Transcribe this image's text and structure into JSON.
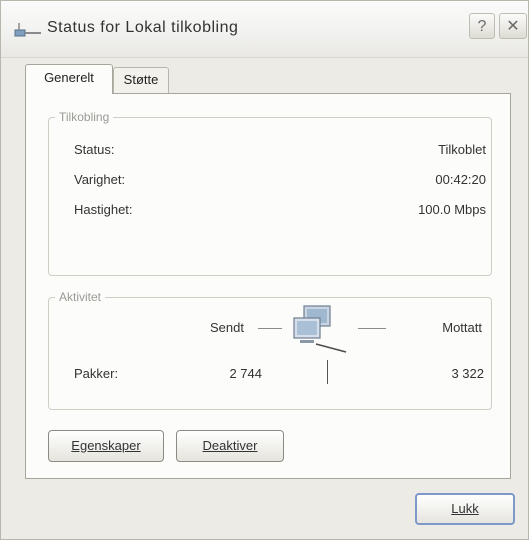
{
  "window": {
    "title": "Status for Lokal tilkobling",
    "help_glyph": "?",
    "close_glyph": "✕"
  },
  "tabs": [
    {
      "label": "Generelt"
    },
    {
      "label": "Støtte"
    }
  ],
  "connection": {
    "legend": "Tilkobling",
    "rows": [
      {
        "label": "Status:",
        "value": "Tilkoblet"
      },
      {
        "label": "Varighet:",
        "value": "00:42:20"
      },
      {
        "label": "Hastighet:",
        "value": "100.0 Mbps"
      }
    ]
  },
  "activity": {
    "legend": "Aktivitet",
    "sent_label": "Sendt",
    "received_label": "Mottatt",
    "packets_label": "Pakker:",
    "packets_sent": "2 744",
    "packets_received": "3 322"
  },
  "buttons": {
    "properties": "Egenskaper",
    "disable": "Deaktiver",
    "close": "Lukk"
  }
}
